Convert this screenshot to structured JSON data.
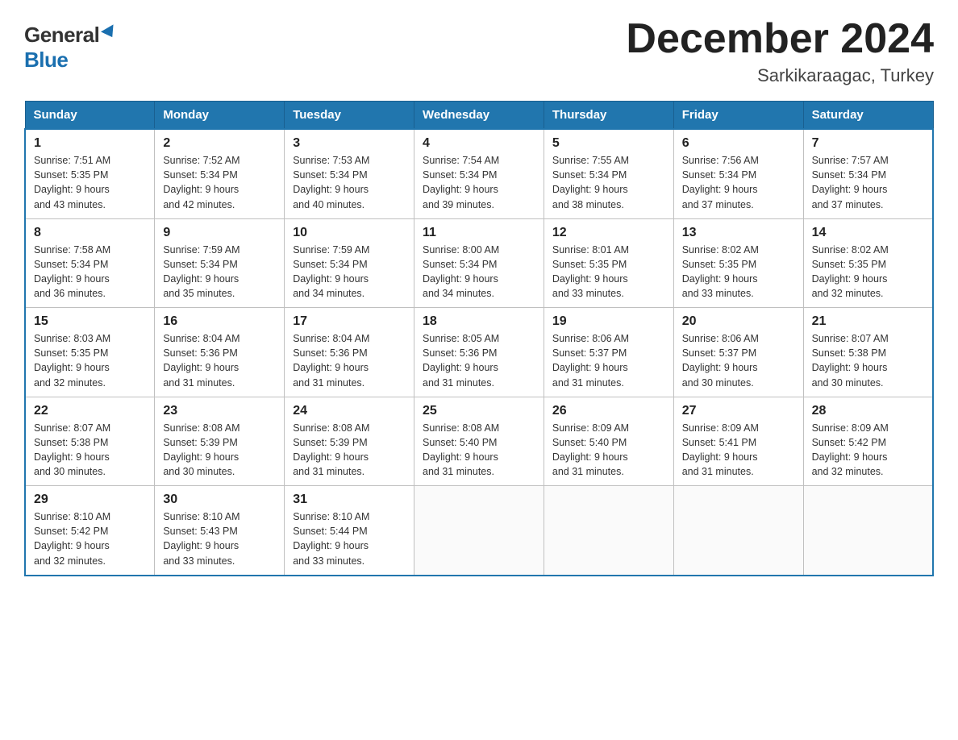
{
  "logo": {
    "general": "General",
    "blue": "Blue"
  },
  "title": "December 2024",
  "subtitle": "Sarkikaraagac, Turkey",
  "days_of_week": [
    "Sunday",
    "Monday",
    "Tuesday",
    "Wednesday",
    "Thursday",
    "Friday",
    "Saturday"
  ],
  "weeks": [
    [
      {
        "day": "1",
        "sunrise": "7:51 AM",
        "sunset": "5:35 PM",
        "daylight": "9 hours and 43 minutes."
      },
      {
        "day": "2",
        "sunrise": "7:52 AM",
        "sunset": "5:34 PM",
        "daylight": "9 hours and 42 minutes."
      },
      {
        "day": "3",
        "sunrise": "7:53 AM",
        "sunset": "5:34 PM",
        "daylight": "9 hours and 40 minutes."
      },
      {
        "day": "4",
        "sunrise": "7:54 AM",
        "sunset": "5:34 PM",
        "daylight": "9 hours and 39 minutes."
      },
      {
        "day": "5",
        "sunrise": "7:55 AM",
        "sunset": "5:34 PM",
        "daylight": "9 hours and 38 minutes."
      },
      {
        "day": "6",
        "sunrise": "7:56 AM",
        "sunset": "5:34 PM",
        "daylight": "9 hours and 37 minutes."
      },
      {
        "day": "7",
        "sunrise": "7:57 AM",
        "sunset": "5:34 PM",
        "daylight": "9 hours and 37 minutes."
      }
    ],
    [
      {
        "day": "8",
        "sunrise": "7:58 AM",
        "sunset": "5:34 PM",
        "daylight": "9 hours and 36 minutes."
      },
      {
        "day": "9",
        "sunrise": "7:59 AM",
        "sunset": "5:34 PM",
        "daylight": "9 hours and 35 minutes."
      },
      {
        "day": "10",
        "sunrise": "7:59 AM",
        "sunset": "5:34 PM",
        "daylight": "9 hours and 34 minutes."
      },
      {
        "day": "11",
        "sunrise": "8:00 AM",
        "sunset": "5:34 PM",
        "daylight": "9 hours and 34 minutes."
      },
      {
        "day": "12",
        "sunrise": "8:01 AM",
        "sunset": "5:35 PM",
        "daylight": "9 hours and 33 minutes."
      },
      {
        "day": "13",
        "sunrise": "8:02 AM",
        "sunset": "5:35 PM",
        "daylight": "9 hours and 33 minutes."
      },
      {
        "day": "14",
        "sunrise": "8:02 AM",
        "sunset": "5:35 PM",
        "daylight": "9 hours and 32 minutes."
      }
    ],
    [
      {
        "day": "15",
        "sunrise": "8:03 AM",
        "sunset": "5:35 PM",
        "daylight": "9 hours and 32 minutes."
      },
      {
        "day": "16",
        "sunrise": "8:04 AM",
        "sunset": "5:36 PM",
        "daylight": "9 hours and 31 minutes."
      },
      {
        "day": "17",
        "sunrise": "8:04 AM",
        "sunset": "5:36 PM",
        "daylight": "9 hours and 31 minutes."
      },
      {
        "day": "18",
        "sunrise": "8:05 AM",
        "sunset": "5:36 PM",
        "daylight": "9 hours and 31 minutes."
      },
      {
        "day": "19",
        "sunrise": "8:06 AM",
        "sunset": "5:37 PM",
        "daylight": "9 hours and 31 minutes."
      },
      {
        "day": "20",
        "sunrise": "8:06 AM",
        "sunset": "5:37 PM",
        "daylight": "9 hours and 30 minutes."
      },
      {
        "day": "21",
        "sunrise": "8:07 AM",
        "sunset": "5:38 PM",
        "daylight": "9 hours and 30 minutes."
      }
    ],
    [
      {
        "day": "22",
        "sunrise": "8:07 AM",
        "sunset": "5:38 PM",
        "daylight": "9 hours and 30 minutes."
      },
      {
        "day": "23",
        "sunrise": "8:08 AM",
        "sunset": "5:39 PM",
        "daylight": "9 hours and 30 minutes."
      },
      {
        "day": "24",
        "sunrise": "8:08 AM",
        "sunset": "5:39 PM",
        "daylight": "9 hours and 31 minutes."
      },
      {
        "day": "25",
        "sunrise": "8:08 AM",
        "sunset": "5:40 PM",
        "daylight": "9 hours and 31 minutes."
      },
      {
        "day": "26",
        "sunrise": "8:09 AM",
        "sunset": "5:40 PM",
        "daylight": "9 hours and 31 minutes."
      },
      {
        "day": "27",
        "sunrise": "8:09 AM",
        "sunset": "5:41 PM",
        "daylight": "9 hours and 31 minutes."
      },
      {
        "day": "28",
        "sunrise": "8:09 AM",
        "sunset": "5:42 PM",
        "daylight": "9 hours and 32 minutes."
      }
    ],
    [
      {
        "day": "29",
        "sunrise": "8:10 AM",
        "sunset": "5:42 PM",
        "daylight": "9 hours and 32 minutes."
      },
      {
        "day": "30",
        "sunrise": "8:10 AM",
        "sunset": "5:43 PM",
        "daylight": "9 hours and 33 minutes."
      },
      {
        "day": "31",
        "sunrise": "8:10 AM",
        "sunset": "5:44 PM",
        "daylight": "9 hours and 33 minutes."
      },
      null,
      null,
      null,
      null
    ]
  ],
  "labels": {
    "sunrise": "Sunrise:",
    "sunset": "Sunset:",
    "daylight": "Daylight:"
  }
}
